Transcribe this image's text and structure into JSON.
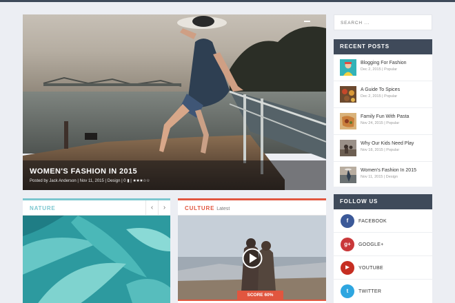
{
  "hero": {
    "title": "WOMEN'S FASHION IN 2015",
    "meta": "Posted by Jack Anderson | Nov 11, 2015 | Design | 0",
    "comment_icon": "comment-icon",
    "rating_stars": "★★★☆☆",
    "rating": 3
  },
  "nature": {
    "label": "NATURE",
    "prev_icon": "‹",
    "next_icon": "›"
  },
  "culture": {
    "label": "CULTURE",
    "sublabel": "Latest",
    "score": "SCORE 60%",
    "play_icon": "play-icon"
  },
  "sidebar": {
    "search": {
      "placeholder": "SEARCH ..."
    },
    "recent_posts": {
      "heading": "RECENT POSTS",
      "items": [
        {
          "title": "Blogging For Fashion",
          "meta": "Dec 2, 2015 | Popular"
        },
        {
          "title": "A Guide To Spices",
          "meta": "Dec 2, 2015 | Popular"
        },
        {
          "title": "Family Fun With Pasta",
          "meta": "Nov 24, 2015 | Popular"
        },
        {
          "title": "Why Our Kids Need Play",
          "meta": "Nov 18, 2015 | Popular"
        },
        {
          "title": "Women's Fashion In 2015",
          "meta": "Nov 11, 2015 | Design"
        }
      ]
    },
    "follow_us": {
      "heading": "FOLLOW US",
      "items": [
        {
          "label": "FACEBOOK",
          "glyph": "f",
          "color": "#3b5998"
        },
        {
          "label": "GOOGLE+",
          "glyph": "g+",
          "color": "#c9383a"
        },
        {
          "label": "YOUTUBE",
          "glyph": "▶",
          "color": "#c62e22"
        },
        {
          "label": "TWITTER",
          "glyph": "t",
          "color": "#2ea6e0"
        }
      ]
    }
  },
  "colors": {
    "accent_nature": "#7bc6cf",
    "accent_culture": "#e1563f",
    "sidebar_header": "#3f4a5a"
  }
}
